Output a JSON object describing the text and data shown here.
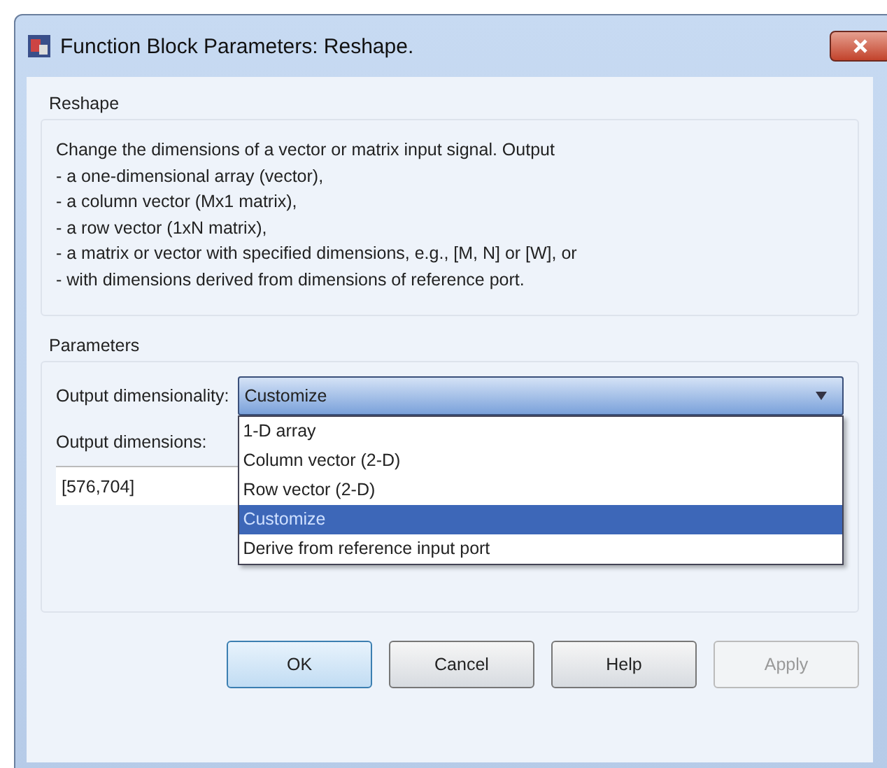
{
  "window": {
    "title": "Function Block Parameters: Reshape."
  },
  "description": {
    "title": "Reshape",
    "lines": [
      "Change the dimensions of a vector or matrix input signal. Output",
      "- a one-dimensional array (vector),",
      "- a column vector (Mx1 matrix),",
      "- a row vector (1xN matrix),",
      "- a matrix or vector with specified dimensions, e.g., [M, N] or [W], or",
      "- with dimensions derived from dimensions of reference port."
    ]
  },
  "parameters": {
    "title": "Parameters",
    "output_dimensionality": {
      "label": "Output dimensionality:",
      "value": "Customize",
      "expanded": true,
      "options": [
        {
          "label": "1-D array",
          "selected": false
        },
        {
          "label": "Column vector (2-D)",
          "selected": false
        },
        {
          "label": "Row vector (2-D)",
          "selected": false
        },
        {
          "label": "Customize",
          "selected": true
        },
        {
          "label": "Derive from reference input port",
          "selected": false
        }
      ]
    },
    "output_dimensions": {
      "label": "Output dimensions:",
      "value": "[576,704]"
    }
  },
  "buttons": [
    {
      "label": "OK",
      "default": true,
      "disabled": false
    },
    {
      "label": "Cancel",
      "default": false,
      "disabled": false
    },
    {
      "label": "Help",
      "default": false,
      "disabled": false
    },
    {
      "label": "Apply",
      "default": false,
      "disabled": true
    }
  ]
}
